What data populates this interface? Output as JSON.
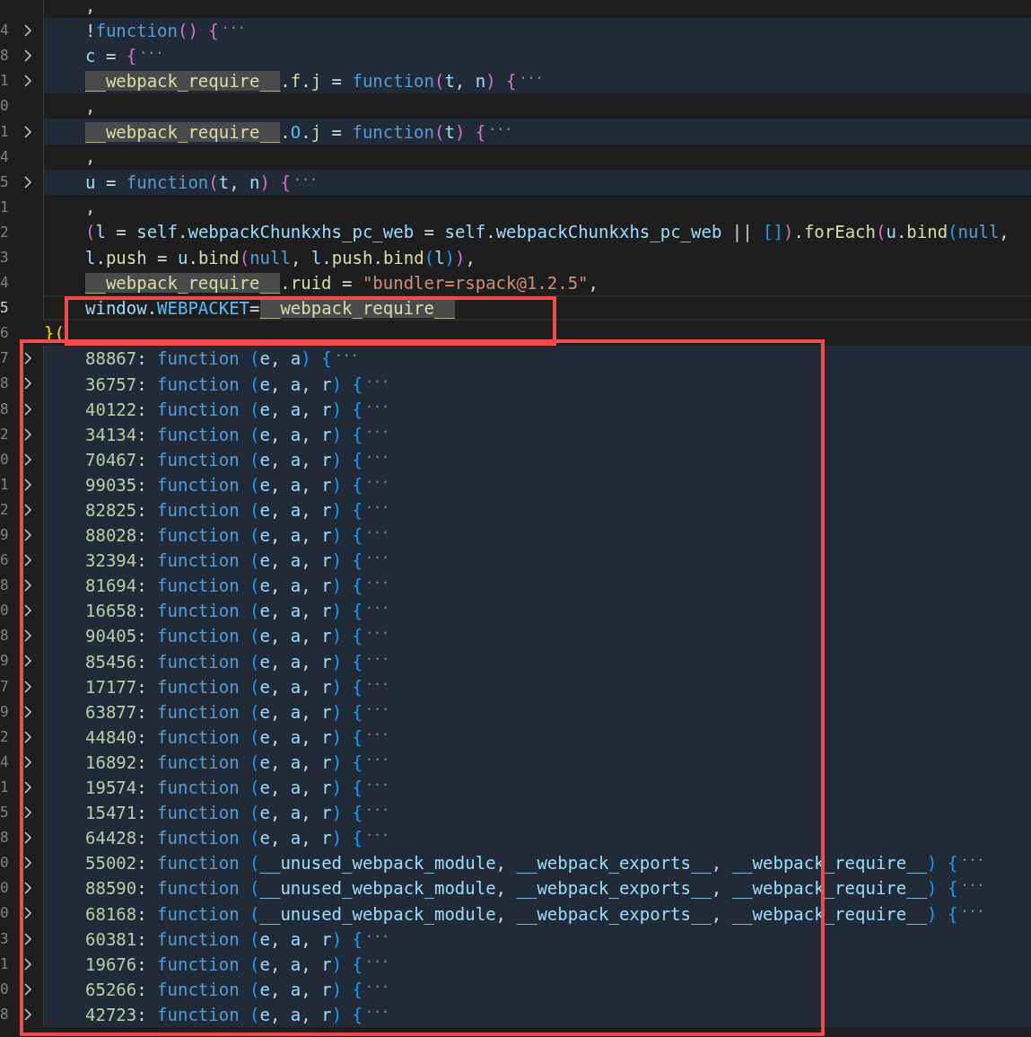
{
  "editor": {
    "lines": [
      {
        "folded": false,
        "highlighted": false,
        "current": false,
        "indented": true,
        "tokens": [
          {
            "kind": "p",
            "text": ","
          }
        ]
      },
      {
        "number": "4",
        "folded": true,
        "highlighted": true,
        "current": false,
        "indented": true,
        "tokens": [
          {
            "kind": "p",
            "text": "!"
          },
          {
            "kind": "k",
            "text": "function"
          },
          {
            "kind": "b2",
            "text": "()"
          },
          {
            "kind": "b2",
            "text": " {"
          },
          {
            "kind": "f",
            "text": "···"
          }
        ]
      },
      {
        "number": "8",
        "folded": true,
        "highlighted": true,
        "current": false,
        "indented": true,
        "tokens": [
          {
            "kind": "v",
            "text": "c"
          },
          {
            "kind": "p",
            "text": " = "
          },
          {
            "kind": "b2",
            "text": "{"
          },
          {
            "kind": "f",
            "text": "···"
          }
        ]
      },
      {
        "number": "1",
        "folded": true,
        "highlighted": true,
        "current": false,
        "indented": true,
        "tokens": [
          {
            "kind": "h",
            "text": "__webpack_require__"
          },
          {
            "kind": "m",
            "text": ".f.j"
          },
          {
            "kind": "p",
            "text": " = "
          },
          {
            "kind": "k",
            "text": "function"
          },
          {
            "kind": "b2",
            "text": "("
          },
          {
            "kind": "v",
            "text": "t"
          },
          {
            "kind": "p",
            "text": ", "
          },
          {
            "kind": "v",
            "text": "n"
          },
          {
            "kind": "b2",
            "text": ")"
          },
          {
            "kind": "b2",
            "text": " {"
          },
          {
            "kind": "f",
            "text": "···"
          }
        ]
      },
      {
        "number": "0",
        "folded": false,
        "highlighted": false,
        "current": false,
        "indented": true,
        "tokens": [
          {
            "kind": "p",
            "text": ","
          }
        ]
      },
      {
        "number": "1",
        "folded": true,
        "highlighted": true,
        "current": false,
        "indented": true,
        "tokens": [
          {
            "kind": "h",
            "text": "__webpack_require__"
          },
          {
            "kind": "m",
            "text": "."
          },
          {
            "kind": "c",
            "text": "O"
          },
          {
            "kind": "m",
            "text": ".j"
          },
          {
            "kind": "p",
            "text": " = "
          },
          {
            "kind": "k",
            "text": "function"
          },
          {
            "kind": "b2",
            "text": "("
          },
          {
            "kind": "v",
            "text": "t"
          },
          {
            "kind": "b2",
            "text": ")"
          },
          {
            "kind": "b2",
            "text": " {"
          },
          {
            "kind": "f",
            "text": "···"
          }
        ]
      },
      {
        "number": "4",
        "folded": false,
        "highlighted": false,
        "current": false,
        "indented": true,
        "tokens": [
          {
            "kind": "p",
            "text": ","
          }
        ]
      },
      {
        "number": "5",
        "folded": true,
        "highlighted": true,
        "current": false,
        "indented": true,
        "tokens": [
          {
            "kind": "v",
            "text": "u"
          },
          {
            "kind": "p",
            "text": " = "
          },
          {
            "kind": "k",
            "text": "function"
          },
          {
            "kind": "b2",
            "text": "("
          },
          {
            "kind": "v",
            "text": "t"
          },
          {
            "kind": "p",
            "text": ", "
          },
          {
            "kind": "v",
            "text": "n"
          },
          {
            "kind": "b2",
            "text": ")"
          },
          {
            "kind": "b2",
            "text": " {"
          },
          {
            "kind": "f",
            "text": "···"
          }
        ]
      },
      {
        "number": "1",
        "folded": false,
        "highlighted": false,
        "current": false,
        "indented": true,
        "tokens": [
          {
            "kind": "p",
            "text": ","
          }
        ]
      },
      {
        "number": "2",
        "folded": false,
        "highlighted": false,
        "current": false,
        "indented": true,
        "tokens": [
          {
            "kind": "b2",
            "text": "("
          },
          {
            "kind": "v",
            "text": "l"
          },
          {
            "kind": "p",
            "text": " = "
          },
          {
            "kind": "v",
            "text": "self"
          },
          {
            "kind": "p",
            "text": "."
          },
          {
            "kind": "v",
            "text": "webpackChunkxhs_pc_web"
          },
          {
            "kind": "p",
            "text": " = "
          },
          {
            "kind": "v",
            "text": "self"
          },
          {
            "kind": "p",
            "text": "."
          },
          {
            "kind": "v",
            "text": "webpackChunkxhs_pc_web"
          },
          {
            "kind": "p",
            "text": " || "
          },
          {
            "kind": "b3",
            "text": "[]"
          },
          {
            "kind": "b2",
            "text": ")"
          },
          {
            "kind": "p",
            "text": "."
          },
          {
            "kind": "m",
            "text": "forEach"
          },
          {
            "kind": "b2",
            "text": "("
          },
          {
            "kind": "v",
            "text": "u"
          },
          {
            "kind": "p",
            "text": "."
          },
          {
            "kind": "m",
            "text": "bind"
          },
          {
            "kind": "b3",
            "text": "("
          },
          {
            "kind": "k",
            "text": "null"
          },
          {
            "kind": "p",
            "text": ","
          }
        ]
      },
      {
        "number": "3",
        "folded": false,
        "highlighted": false,
        "current": false,
        "indented": true,
        "tokens": [
          {
            "kind": "v",
            "text": "l"
          },
          {
            "kind": "p",
            "text": "."
          },
          {
            "kind": "m",
            "text": "push"
          },
          {
            "kind": "p",
            "text": " = "
          },
          {
            "kind": "v",
            "text": "u"
          },
          {
            "kind": "p",
            "text": "."
          },
          {
            "kind": "m",
            "text": "bind"
          },
          {
            "kind": "b2",
            "text": "("
          },
          {
            "kind": "k",
            "text": "null"
          },
          {
            "kind": "p",
            "text": ", "
          },
          {
            "kind": "v",
            "text": "l"
          },
          {
            "kind": "p",
            "text": "."
          },
          {
            "kind": "m",
            "text": "push"
          },
          {
            "kind": "p",
            "text": "."
          },
          {
            "kind": "m",
            "text": "bind"
          },
          {
            "kind": "b3",
            "text": "("
          },
          {
            "kind": "v",
            "text": "l"
          },
          {
            "kind": "b3",
            "text": ")"
          },
          {
            "kind": "b2",
            "text": ")"
          },
          {
            "kind": "p",
            "text": ","
          }
        ]
      },
      {
        "number": "4",
        "folded": false,
        "highlighted": false,
        "current": false,
        "indented": true,
        "tokens": [
          {
            "kind": "h",
            "text": "__webpack_require__"
          },
          {
            "kind": "p",
            "text": "."
          },
          {
            "kind": "m",
            "text": "ruid"
          },
          {
            "kind": "p",
            "text": " = "
          },
          {
            "kind": "s",
            "text": "\"bundler=rspack@1.2.5\""
          },
          {
            "kind": "p",
            "text": ","
          }
        ]
      },
      {
        "number": "5",
        "folded": false,
        "highlighted": false,
        "current": true,
        "indented": true,
        "tokens": [
          {
            "kind": "v",
            "text": "window"
          },
          {
            "kind": "p",
            "text": "."
          },
          {
            "kind": "c",
            "text": "WEBPACKET"
          },
          {
            "kind": "p",
            "text": "="
          },
          {
            "kind": "h",
            "text": "__webpack_require__"
          }
        ]
      },
      {
        "number": "6",
        "folded": false,
        "highlighted": false,
        "current": false,
        "indented": false,
        "tokens": [
          {
            "kind": "b1",
            "text": "}("
          }
        ]
      },
      {
        "number": "7",
        "folded": true,
        "highlighted": true,
        "current": false,
        "indented": true,
        "tokens": [
          {
            "kind": "n",
            "text": "88867"
          },
          {
            "kind": "p",
            "text": ": "
          },
          {
            "kind": "k",
            "text": "function"
          },
          {
            "kind": "b3",
            "text": " ("
          },
          {
            "kind": "v",
            "text": "e"
          },
          {
            "kind": "p",
            "text": ", "
          },
          {
            "kind": "v",
            "text": "a"
          },
          {
            "kind": "b3",
            "text": ")"
          },
          {
            "kind": "b3",
            "text": " {"
          },
          {
            "kind": "f",
            "text": "···"
          }
        ]
      },
      {
        "number": "8",
        "folded": true,
        "highlighted": true,
        "current": false,
        "indented": true,
        "tokens": [
          {
            "kind": "n",
            "text": "36757"
          },
          {
            "kind": "p",
            "text": ": "
          },
          {
            "kind": "k",
            "text": "function"
          },
          {
            "kind": "b3",
            "text": " ("
          },
          {
            "kind": "v",
            "text": "e"
          },
          {
            "kind": "p",
            "text": ", "
          },
          {
            "kind": "v",
            "text": "a"
          },
          {
            "kind": "p",
            "text": ", "
          },
          {
            "kind": "v",
            "text": "r"
          },
          {
            "kind": "b3",
            "text": ")"
          },
          {
            "kind": "b3",
            "text": " {"
          },
          {
            "kind": "f",
            "text": "···"
          }
        ]
      },
      {
        "number": "8",
        "folded": true,
        "highlighted": true,
        "current": false,
        "indented": true,
        "tokens": [
          {
            "kind": "n",
            "text": "40122"
          },
          {
            "kind": "p",
            "text": ": "
          },
          {
            "kind": "k",
            "text": "function"
          },
          {
            "kind": "b3",
            "text": " ("
          },
          {
            "kind": "v",
            "text": "e"
          },
          {
            "kind": "p",
            "text": ", "
          },
          {
            "kind": "v",
            "text": "a"
          },
          {
            "kind": "p",
            "text": ", "
          },
          {
            "kind": "v",
            "text": "r"
          },
          {
            "kind": "b3",
            "text": ")"
          },
          {
            "kind": "b3",
            "text": " {"
          },
          {
            "kind": "f",
            "text": "···"
          }
        ]
      },
      {
        "number": "2",
        "folded": true,
        "highlighted": true,
        "current": false,
        "indented": true,
        "tokens": [
          {
            "kind": "n",
            "text": "34134"
          },
          {
            "kind": "p",
            "text": ": "
          },
          {
            "kind": "k",
            "text": "function"
          },
          {
            "kind": "b3",
            "text": " ("
          },
          {
            "kind": "v",
            "text": "e"
          },
          {
            "kind": "p",
            "text": ", "
          },
          {
            "kind": "v",
            "text": "a"
          },
          {
            "kind": "p",
            "text": ", "
          },
          {
            "kind": "v",
            "text": "r"
          },
          {
            "kind": "b3",
            "text": ")"
          },
          {
            "kind": "b3",
            "text": " {"
          },
          {
            "kind": "f",
            "text": "···"
          }
        ]
      },
      {
        "number": "0",
        "folded": true,
        "highlighted": true,
        "current": false,
        "indented": true,
        "tokens": [
          {
            "kind": "n",
            "text": "70467"
          },
          {
            "kind": "p",
            "text": ": "
          },
          {
            "kind": "k",
            "text": "function"
          },
          {
            "kind": "b3",
            "text": " ("
          },
          {
            "kind": "v",
            "text": "e"
          },
          {
            "kind": "p",
            "text": ", "
          },
          {
            "kind": "v",
            "text": "a"
          },
          {
            "kind": "p",
            "text": ", "
          },
          {
            "kind": "v",
            "text": "r"
          },
          {
            "kind": "b3",
            "text": ")"
          },
          {
            "kind": "b3",
            "text": " {"
          },
          {
            "kind": "f",
            "text": "···"
          }
        ]
      },
      {
        "number": "1",
        "folded": true,
        "highlighted": true,
        "current": false,
        "indented": true,
        "tokens": [
          {
            "kind": "n",
            "text": "99035"
          },
          {
            "kind": "p",
            "text": ": "
          },
          {
            "kind": "k",
            "text": "function"
          },
          {
            "kind": "b3",
            "text": " ("
          },
          {
            "kind": "v",
            "text": "e"
          },
          {
            "kind": "p",
            "text": ", "
          },
          {
            "kind": "v",
            "text": "a"
          },
          {
            "kind": "p",
            "text": ", "
          },
          {
            "kind": "v",
            "text": "r"
          },
          {
            "kind": "b3",
            "text": ")"
          },
          {
            "kind": "b3",
            "text": " {"
          },
          {
            "kind": "f",
            "text": "···"
          }
        ]
      },
      {
        "number": "2",
        "folded": true,
        "highlighted": true,
        "current": false,
        "indented": true,
        "tokens": [
          {
            "kind": "n",
            "text": "82825"
          },
          {
            "kind": "p",
            "text": ": "
          },
          {
            "kind": "k",
            "text": "function"
          },
          {
            "kind": "b3",
            "text": " ("
          },
          {
            "kind": "v",
            "text": "e"
          },
          {
            "kind": "p",
            "text": ", "
          },
          {
            "kind": "v",
            "text": "a"
          },
          {
            "kind": "p",
            "text": ", "
          },
          {
            "kind": "v",
            "text": "r"
          },
          {
            "kind": "b3",
            "text": ")"
          },
          {
            "kind": "b3",
            "text": " {"
          },
          {
            "kind": "f",
            "text": "···"
          }
        ]
      },
      {
        "number": "9",
        "folded": true,
        "highlighted": true,
        "current": false,
        "indented": true,
        "tokens": [
          {
            "kind": "n",
            "text": "88028"
          },
          {
            "kind": "p",
            "text": ": "
          },
          {
            "kind": "k",
            "text": "function"
          },
          {
            "kind": "b3",
            "text": " ("
          },
          {
            "kind": "v",
            "text": "e"
          },
          {
            "kind": "p",
            "text": ", "
          },
          {
            "kind": "v",
            "text": "a"
          },
          {
            "kind": "p",
            "text": ", "
          },
          {
            "kind": "v",
            "text": "r"
          },
          {
            "kind": "b3",
            "text": ")"
          },
          {
            "kind": "b3",
            "text": " {"
          },
          {
            "kind": "f",
            "text": "···"
          }
        ]
      },
      {
        "number": "6",
        "folded": true,
        "highlighted": true,
        "current": false,
        "indented": true,
        "tokens": [
          {
            "kind": "n",
            "text": "32394"
          },
          {
            "kind": "p",
            "text": ": "
          },
          {
            "kind": "k",
            "text": "function"
          },
          {
            "kind": "b3",
            "text": " ("
          },
          {
            "kind": "v",
            "text": "e"
          },
          {
            "kind": "p",
            "text": ", "
          },
          {
            "kind": "v",
            "text": "a"
          },
          {
            "kind": "p",
            "text": ", "
          },
          {
            "kind": "v",
            "text": "r"
          },
          {
            "kind": "b3",
            "text": ")"
          },
          {
            "kind": "b3",
            "text": " {"
          },
          {
            "kind": "f",
            "text": "···"
          }
        ]
      },
      {
        "number": "8",
        "folded": true,
        "highlighted": true,
        "current": false,
        "indented": true,
        "tokens": [
          {
            "kind": "n",
            "text": "81694"
          },
          {
            "kind": "p",
            "text": ": "
          },
          {
            "kind": "k",
            "text": "function"
          },
          {
            "kind": "b3",
            "text": " ("
          },
          {
            "kind": "v",
            "text": "e"
          },
          {
            "kind": "p",
            "text": ", "
          },
          {
            "kind": "v",
            "text": "a"
          },
          {
            "kind": "p",
            "text": ", "
          },
          {
            "kind": "v",
            "text": "r"
          },
          {
            "kind": "b3",
            "text": ")"
          },
          {
            "kind": "b3",
            "text": " {"
          },
          {
            "kind": "f",
            "text": "···"
          }
        ]
      },
      {
        "number": "0",
        "folded": true,
        "highlighted": true,
        "current": false,
        "indented": true,
        "tokens": [
          {
            "kind": "n",
            "text": "16658"
          },
          {
            "kind": "p",
            "text": ": "
          },
          {
            "kind": "k",
            "text": "function"
          },
          {
            "kind": "b3",
            "text": " ("
          },
          {
            "kind": "v",
            "text": "e"
          },
          {
            "kind": "p",
            "text": ", "
          },
          {
            "kind": "v",
            "text": "a"
          },
          {
            "kind": "p",
            "text": ", "
          },
          {
            "kind": "v",
            "text": "r"
          },
          {
            "kind": "b3",
            "text": ")"
          },
          {
            "kind": "b3",
            "text": " {"
          },
          {
            "kind": "f",
            "text": "···"
          }
        ]
      },
      {
        "number": "8",
        "folded": true,
        "highlighted": true,
        "current": false,
        "indented": true,
        "tokens": [
          {
            "kind": "n",
            "text": "90405"
          },
          {
            "kind": "p",
            "text": ": "
          },
          {
            "kind": "k",
            "text": "function"
          },
          {
            "kind": "b3",
            "text": " ("
          },
          {
            "kind": "v",
            "text": "e"
          },
          {
            "kind": "p",
            "text": ", "
          },
          {
            "kind": "v",
            "text": "a"
          },
          {
            "kind": "p",
            "text": ", "
          },
          {
            "kind": "v",
            "text": "r"
          },
          {
            "kind": "b3",
            "text": ")"
          },
          {
            "kind": "b3",
            "text": " {"
          },
          {
            "kind": "f",
            "text": "···"
          }
        ]
      },
      {
        "number": "9",
        "folded": true,
        "highlighted": true,
        "current": false,
        "indented": true,
        "tokens": [
          {
            "kind": "n",
            "text": "85456"
          },
          {
            "kind": "p",
            "text": ": "
          },
          {
            "kind": "k",
            "text": "function"
          },
          {
            "kind": "b3",
            "text": " ("
          },
          {
            "kind": "v",
            "text": "e"
          },
          {
            "kind": "p",
            "text": ", "
          },
          {
            "kind": "v",
            "text": "a"
          },
          {
            "kind": "p",
            "text": ", "
          },
          {
            "kind": "v",
            "text": "r"
          },
          {
            "kind": "b3",
            "text": ")"
          },
          {
            "kind": "b3",
            "text": " {"
          },
          {
            "kind": "f",
            "text": "···"
          }
        ]
      },
      {
        "number": "7",
        "folded": true,
        "highlighted": true,
        "current": false,
        "indented": true,
        "tokens": [
          {
            "kind": "n",
            "text": "17177"
          },
          {
            "kind": "p",
            "text": ": "
          },
          {
            "kind": "k",
            "text": "function"
          },
          {
            "kind": "b3",
            "text": " ("
          },
          {
            "kind": "v",
            "text": "e"
          },
          {
            "kind": "p",
            "text": ", "
          },
          {
            "kind": "v",
            "text": "a"
          },
          {
            "kind": "p",
            "text": ", "
          },
          {
            "kind": "v",
            "text": "r"
          },
          {
            "kind": "b3",
            "text": ")"
          },
          {
            "kind": "b3",
            "text": " {"
          },
          {
            "kind": "f",
            "text": "···"
          }
        ]
      },
      {
        "number": "9",
        "folded": true,
        "highlighted": true,
        "current": false,
        "indented": true,
        "tokens": [
          {
            "kind": "n",
            "text": "63877"
          },
          {
            "kind": "p",
            "text": ": "
          },
          {
            "kind": "k",
            "text": "function"
          },
          {
            "kind": "b3",
            "text": " ("
          },
          {
            "kind": "v",
            "text": "e"
          },
          {
            "kind": "p",
            "text": ", "
          },
          {
            "kind": "v",
            "text": "a"
          },
          {
            "kind": "p",
            "text": ", "
          },
          {
            "kind": "v",
            "text": "r"
          },
          {
            "kind": "b3",
            "text": ")"
          },
          {
            "kind": "b3",
            "text": " {"
          },
          {
            "kind": "f",
            "text": "···"
          }
        ]
      },
      {
        "number": "2",
        "folded": true,
        "highlighted": true,
        "current": false,
        "indented": true,
        "tokens": [
          {
            "kind": "n",
            "text": "44840"
          },
          {
            "kind": "p",
            "text": ": "
          },
          {
            "kind": "k",
            "text": "function"
          },
          {
            "kind": "b3",
            "text": " ("
          },
          {
            "kind": "v",
            "text": "e"
          },
          {
            "kind": "p",
            "text": ", "
          },
          {
            "kind": "v",
            "text": "a"
          },
          {
            "kind": "p",
            "text": ", "
          },
          {
            "kind": "v",
            "text": "r"
          },
          {
            "kind": "b3",
            "text": ")"
          },
          {
            "kind": "b3",
            "text": " {"
          },
          {
            "kind": "f",
            "text": "···"
          }
        ]
      },
      {
        "number": "4",
        "folded": true,
        "highlighted": true,
        "current": false,
        "indented": true,
        "tokens": [
          {
            "kind": "n",
            "text": "16892"
          },
          {
            "kind": "p",
            "text": ": "
          },
          {
            "kind": "k",
            "text": "function"
          },
          {
            "kind": "b3",
            "text": " ("
          },
          {
            "kind": "v",
            "text": "e"
          },
          {
            "kind": "p",
            "text": ", "
          },
          {
            "kind": "v",
            "text": "a"
          },
          {
            "kind": "p",
            "text": ", "
          },
          {
            "kind": "v",
            "text": "r"
          },
          {
            "kind": "b3",
            "text": ")"
          },
          {
            "kind": "b3",
            "text": " {"
          },
          {
            "kind": "f",
            "text": "···"
          }
        ]
      },
      {
        "number": "1",
        "folded": true,
        "highlighted": true,
        "current": false,
        "indented": true,
        "tokens": [
          {
            "kind": "n",
            "text": "19574"
          },
          {
            "kind": "p",
            "text": ": "
          },
          {
            "kind": "k",
            "text": "function"
          },
          {
            "kind": "b3",
            "text": " ("
          },
          {
            "kind": "v",
            "text": "e"
          },
          {
            "kind": "p",
            "text": ", "
          },
          {
            "kind": "v",
            "text": "a"
          },
          {
            "kind": "p",
            "text": ", "
          },
          {
            "kind": "v",
            "text": "r"
          },
          {
            "kind": "b3",
            "text": ")"
          },
          {
            "kind": "b3",
            "text": " {"
          },
          {
            "kind": "f",
            "text": "···"
          }
        ]
      },
      {
        "number": "5",
        "folded": true,
        "highlighted": true,
        "current": false,
        "indented": true,
        "tokens": [
          {
            "kind": "n",
            "text": "15471"
          },
          {
            "kind": "p",
            "text": ": "
          },
          {
            "kind": "k",
            "text": "function"
          },
          {
            "kind": "b3",
            "text": " ("
          },
          {
            "kind": "v",
            "text": "e"
          },
          {
            "kind": "p",
            "text": ", "
          },
          {
            "kind": "v",
            "text": "a"
          },
          {
            "kind": "p",
            "text": ", "
          },
          {
            "kind": "v",
            "text": "r"
          },
          {
            "kind": "b3",
            "text": ")"
          },
          {
            "kind": "b3",
            "text": " {"
          },
          {
            "kind": "f",
            "text": "···"
          }
        ]
      },
      {
        "number": "8",
        "folded": true,
        "highlighted": true,
        "current": false,
        "indented": true,
        "tokens": [
          {
            "kind": "n",
            "text": "64428"
          },
          {
            "kind": "p",
            "text": ": "
          },
          {
            "kind": "k",
            "text": "function"
          },
          {
            "kind": "b3",
            "text": " ("
          },
          {
            "kind": "v",
            "text": "e"
          },
          {
            "kind": "p",
            "text": ", "
          },
          {
            "kind": "v",
            "text": "a"
          },
          {
            "kind": "p",
            "text": ", "
          },
          {
            "kind": "v",
            "text": "r"
          },
          {
            "kind": "b3",
            "text": ")"
          },
          {
            "kind": "b3",
            "text": " {"
          },
          {
            "kind": "f",
            "text": "···"
          }
        ]
      },
      {
        "number": "0",
        "folded": true,
        "highlighted": true,
        "current": false,
        "indented": true,
        "tokens": [
          {
            "kind": "n",
            "text": "55002"
          },
          {
            "kind": "p",
            "text": ": "
          },
          {
            "kind": "k",
            "text": "function"
          },
          {
            "kind": "b3",
            "text": " ("
          },
          {
            "kind": "v",
            "text": "__unused_webpack_module"
          },
          {
            "kind": "p",
            "text": ", "
          },
          {
            "kind": "v",
            "text": "__webpack_exports__"
          },
          {
            "kind": "p",
            "text": ", "
          },
          {
            "kind": "v",
            "text": "__webpack_require__"
          },
          {
            "kind": "b3",
            "text": ")"
          },
          {
            "kind": "b3",
            "text": " {"
          },
          {
            "kind": "f",
            "text": "···"
          }
        ]
      },
      {
        "number": "0",
        "folded": true,
        "highlighted": true,
        "current": false,
        "indented": true,
        "tokens": [
          {
            "kind": "n",
            "text": "88590"
          },
          {
            "kind": "p",
            "text": ": "
          },
          {
            "kind": "k",
            "text": "function"
          },
          {
            "kind": "b3",
            "text": " ("
          },
          {
            "kind": "v",
            "text": "__unused_webpack_module"
          },
          {
            "kind": "p",
            "text": ", "
          },
          {
            "kind": "v",
            "text": "__webpack_exports__"
          },
          {
            "kind": "p",
            "text": ", "
          },
          {
            "kind": "v",
            "text": "__webpack_require__"
          },
          {
            "kind": "b3",
            "text": ")"
          },
          {
            "kind": "b3",
            "text": " {"
          },
          {
            "kind": "f",
            "text": "···"
          }
        ]
      },
      {
        "number": "0",
        "folded": true,
        "highlighted": true,
        "current": false,
        "indented": true,
        "tokens": [
          {
            "kind": "n",
            "text": "68168"
          },
          {
            "kind": "p",
            "text": ": "
          },
          {
            "kind": "k",
            "text": "function"
          },
          {
            "kind": "b3",
            "text": " ("
          },
          {
            "kind": "v",
            "text": "__unused_webpack_module"
          },
          {
            "kind": "p",
            "text": ", "
          },
          {
            "kind": "v",
            "text": "__webpack_exports__"
          },
          {
            "kind": "p",
            "text": ", "
          },
          {
            "kind": "v",
            "text": "__webpack_require__"
          },
          {
            "kind": "b3",
            "text": ")"
          },
          {
            "kind": "b3",
            "text": " {"
          },
          {
            "kind": "f",
            "text": "···"
          }
        ]
      },
      {
        "number": "3",
        "folded": true,
        "highlighted": true,
        "current": false,
        "indented": true,
        "tokens": [
          {
            "kind": "n",
            "text": "60381"
          },
          {
            "kind": "p",
            "text": ": "
          },
          {
            "kind": "k",
            "text": "function"
          },
          {
            "kind": "b3",
            "text": " ("
          },
          {
            "kind": "v",
            "text": "e"
          },
          {
            "kind": "p",
            "text": ", "
          },
          {
            "kind": "v",
            "text": "a"
          },
          {
            "kind": "p",
            "text": ", "
          },
          {
            "kind": "v",
            "text": "r"
          },
          {
            "kind": "b3",
            "text": ")"
          },
          {
            "kind": "b3",
            "text": " {"
          },
          {
            "kind": "f",
            "text": "···"
          }
        ]
      },
      {
        "number": "1",
        "folded": true,
        "highlighted": true,
        "current": false,
        "indented": true,
        "tokens": [
          {
            "kind": "n",
            "text": "19676"
          },
          {
            "kind": "p",
            "text": ": "
          },
          {
            "kind": "k",
            "text": "function"
          },
          {
            "kind": "b3",
            "text": " ("
          },
          {
            "kind": "v",
            "text": "e"
          },
          {
            "kind": "p",
            "text": ", "
          },
          {
            "kind": "v",
            "text": "a"
          },
          {
            "kind": "p",
            "text": ", "
          },
          {
            "kind": "v",
            "text": "r"
          },
          {
            "kind": "b3",
            "text": ")"
          },
          {
            "kind": "b3",
            "text": " {"
          },
          {
            "kind": "f",
            "text": "···"
          }
        ]
      },
      {
        "number": "0",
        "folded": true,
        "highlighted": true,
        "current": false,
        "indented": true,
        "tokens": [
          {
            "kind": "n",
            "text": "65266"
          },
          {
            "kind": "p",
            "text": ": "
          },
          {
            "kind": "k",
            "text": "function"
          },
          {
            "kind": "b3",
            "text": " ("
          },
          {
            "kind": "v",
            "text": "e"
          },
          {
            "kind": "p",
            "text": ", "
          },
          {
            "kind": "v",
            "text": "a"
          },
          {
            "kind": "p",
            "text": ", "
          },
          {
            "kind": "v",
            "text": "r"
          },
          {
            "kind": "b3",
            "text": ")"
          },
          {
            "kind": "b3",
            "text": " {"
          },
          {
            "kind": "f",
            "text": "···"
          }
        ]
      },
      {
        "number": "8",
        "folded": true,
        "highlighted": true,
        "current": false,
        "indented": true,
        "tokens": [
          {
            "kind": "n",
            "text": "42723"
          },
          {
            "kind": "p",
            "text": ": "
          },
          {
            "kind": "k",
            "text": "function"
          },
          {
            "kind": "b3",
            "text": " ("
          },
          {
            "kind": "v",
            "text": "e"
          },
          {
            "kind": "p",
            "text": ", "
          },
          {
            "kind": "v",
            "text": "a"
          },
          {
            "kind": "p",
            "text": ", "
          },
          {
            "kind": "v",
            "text": "r"
          },
          {
            "kind": "b3",
            "text": ")"
          },
          {
            "kind": "b3",
            "text": " {"
          },
          {
            "kind": "f",
            "text": "···"
          }
        ]
      }
    ]
  }
}
